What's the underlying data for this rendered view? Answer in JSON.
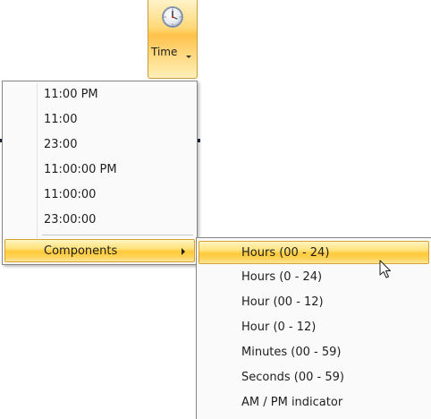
{
  "ribbon": {
    "time_button": {
      "label": "Time",
      "icon": "clock-icon",
      "accent_color": "#ffc24a"
    }
  },
  "menu": {
    "items": [
      {
        "label": "11:00 PM"
      },
      {
        "label": "11:00"
      },
      {
        "label": "23:00"
      },
      {
        "label": "11:00:00 PM"
      },
      {
        "label": "11:00:00"
      },
      {
        "label": "23:00:00"
      }
    ],
    "components": {
      "label": "Components",
      "icon": "chevron-right-icon",
      "highlighted": true
    }
  },
  "submenu": {
    "items": [
      {
        "label": "Hours (00 - 24)",
        "highlighted": true
      },
      {
        "label": "Hours (0 - 24)"
      },
      {
        "label": "Hour (00 - 12)"
      },
      {
        "label": "Hour (0 - 12)"
      },
      {
        "label": "Minutes (00 - 59)"
      },
      {
        "label": "Seconds (00 - 59)"
      },
      {
        "label": "AM / PM indicator"
      }
    ]
  },
  "colors": {
    "highlight": "#ffc93a",
    "highlight_border": "#d5a332",
    "menu_border": "#868686",
    "menu_background": "#fafafa"
  },
  "cursor": {
    "icon": "mouse-pointer-icon"
  }
}
